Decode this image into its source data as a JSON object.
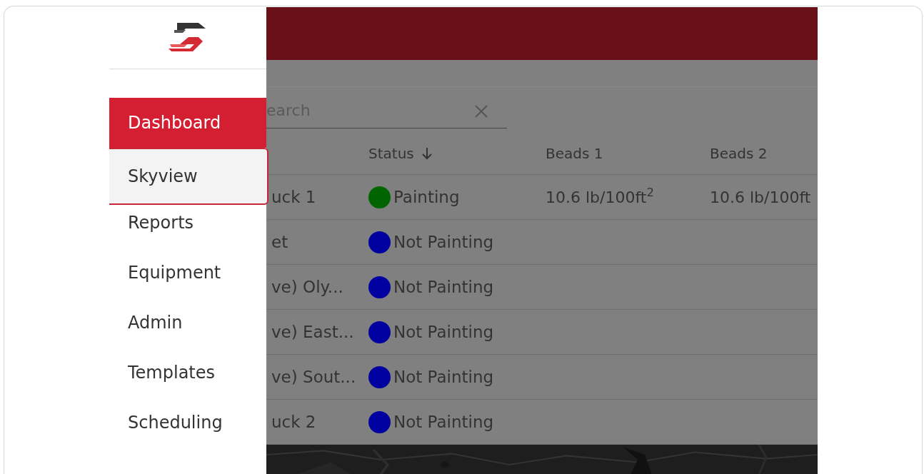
{
  "sidebar": {
    "items": [
      {
        "label": "Dashboard",
        "selected": true,
        "hovered": false
      },
      {
        "label": "Skyview",
        "selected": false,
        "hovered": true
      },
      {
        "label": "Reports",
        "selected": false,
        "hovered": false
      },
      {
        "label": "Equipment",
        "selected": false,
        "hovered": false
      },
      {
        "label": "Admin",
        "selected": false,
        "hovered": false
      },
      {
        "label": "Templates",
        "selected": false,
        "hovered": false
      },
      {
        "label": "Scheduling",
        "selected": false,
        "hovered": false
      }
    ]
  },
  "search": {
    "placeholder": "earch"
  },
  "table": {
    "columns": [
      {
        "label": "Status",
        "sorted": true
      },
      {
        "label": "Beads 1",
        "sorted": false
      },
      {
        "label": "Beads 2",
        "sorted": false
      }
    ],
    "rows": [
      {
        "name": "uck 1",
        "status": "Painting",
        "color": "#006400",
        "beads_1": "10.6 lb/100ft$^{2}$",
        "beads_2": "10.6 lb/100ft"
      },
      {
        "name": "et",
        "status": "Not Painting",
        "color": "#0000a0"
      },
      {
        "name": "ve) Oly...",
        "status": "Not Painting",
        "color": "#0000a0"
      },
      {
        "name": "ve) East...",
        "status": "Not Painting",
        "color": "#0000a0"
      },
      {
        "name": "ve) Sout...",
        "status": "Not Painting",
        "color": "#0000a0"
      },
      {
        "name": "uck 2",
        "status": "Not Painting",
        "color": "#0000a0"
      }
    ]
  }
}
